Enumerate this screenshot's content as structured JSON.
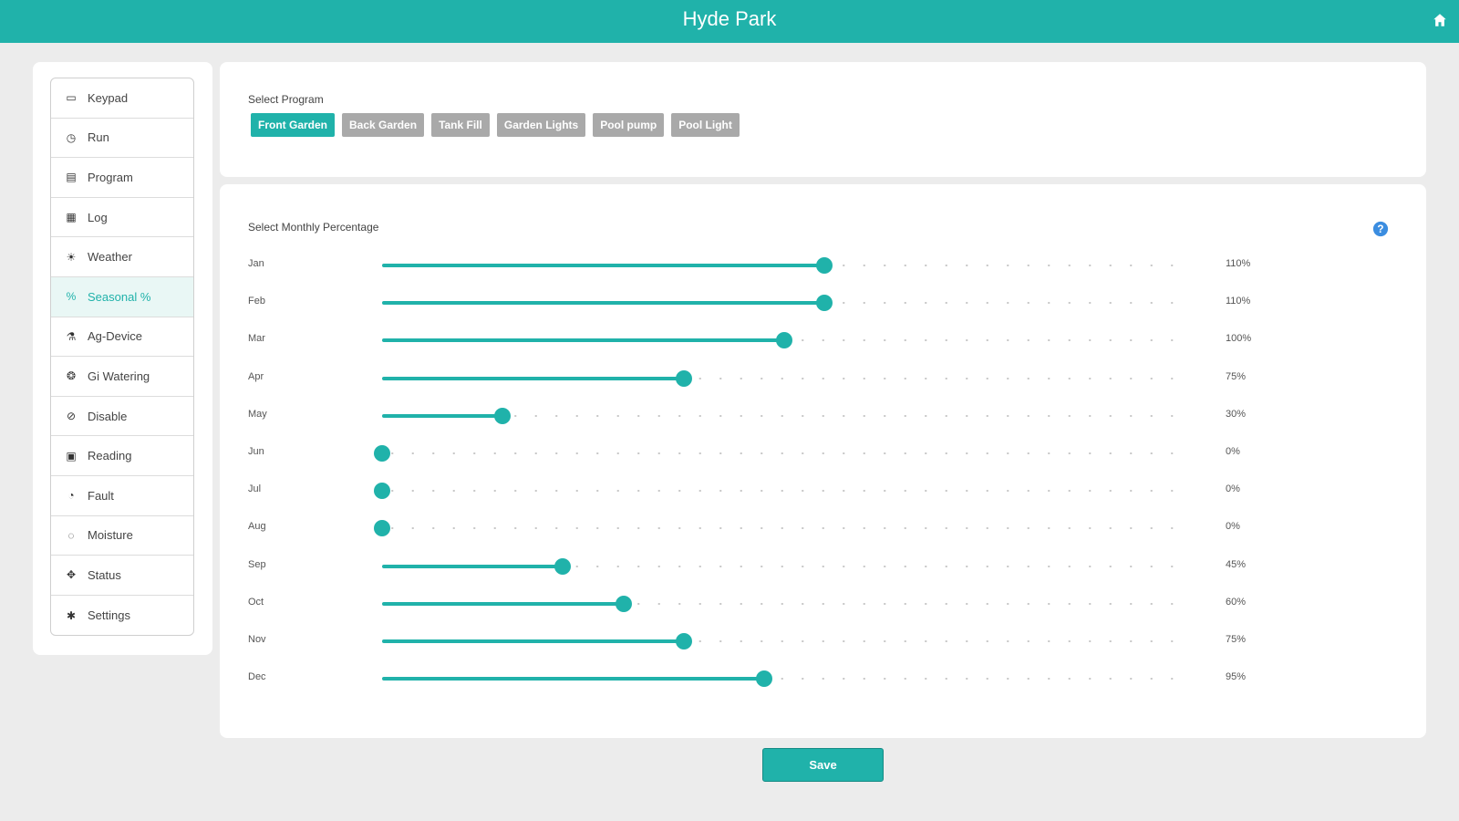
{
  "header": {
    "title": "Hyde Park",
    "home_icon": "home-icon"
  },
  "colors": {
    "accent": "#20b2aa",
    "inactive": "#a9a9a9"
  },
  "sidebar": {
    "items": [
      {
        "label": "Keypad",
        "icon": "monitor-icon"
      },
      {
        "label": "Run",
        "icon": "clock-icon"
      },
      {
        "label": "Program",
        "icon": "calendar-icon"
      },
      {
        "label": "Log",
        "icon": "grid-icon"
      },
      {
        "label": "Weather",
        "icon": "sun-icon"
      },
      {
        "label": "Seasonal %",
        "icon": "percent-icon",
        "active": true
      },
      {
        "label": "Ag-Device",
        "icon": "flask-icon"
      },
      {
        "label": "Gi Watering",
        "icon": "drop-icon"
      },
      {
        "label": "Disable",
        "icon": "disable-icon"
      },
      {
        "label": "Reading",
        "icon": "reading-icon"
      },
      {
        "label": "Fault",
        "icon": "fault-icon"
      },
      {
        "label": "Moisture",
        "icon": "moisture-icon"
      },
      {
        "label": "Status",
        "icon": "status-icon"
      },
      {
        "label": "Settings",
        "icon": "gear-icon"
      }
    ]
  },
  "program": {
    "label": "Select Program",
    "options": [
      "Front Garden",
      "Back Garden",
      "Tank Fill",
      "Garden Lights",
      "Pool pump",
      "Pool Light"
    ],
    "selected": "Front Garden"
  },
  "seasonal": {
    "label": "Select Monthly Percentage",
    "help_icon": "help-icon",
    "max_percent": 200,
    "months": [
      {
        "name": "Jan",
        "value": 110,
        "display": "110%"
      },
      {
        "name": "Feb",
        "value": 110,
        "display": "110%"
      },
      {
        "name": "Mar",
        "value": 100,
        "display": "100%"
      },
      {
        "name": "Apr",
        "value": 75,
        "display": "75%"
      },
      {
        "name": "May",
        "value": 30,
        "display": "30%"
      },
      {
        "name": "Jun",
        "value": 0,
        "display": "0%"
      },
      {
        "name": "Jul",
        "value": 0,
        "display": "0%"
      },
      {
        "name": "Aug",
        "value": 0,
        "display": "0%"
      },
      {
        "name": "Sep",
        "value": 45,
        "display": "45%"
      },
      {
        "name": "Oct",
        "value": 60,
        "display": "60%"
      },
      {
        "name": "Nov",
        "value": 75,
        "display": "75%"
      },
      {
        "name": "Dec",
        "value": 95,
        "display": "95%"
      }
    ]
  },
  "save_label": "Save"
}
